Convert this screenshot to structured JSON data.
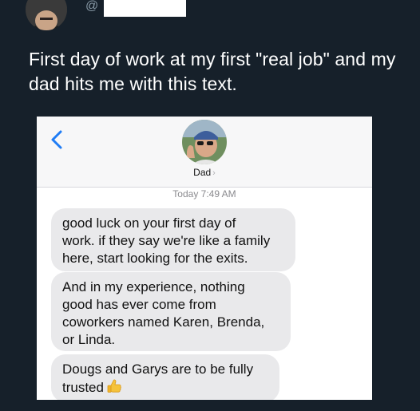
{
  "tweet": {
    "at_symbol": "@",
    "text": "First day of work at my first \"real job\" and my dad hits me with this text."
  },
  "messages_app": {
    "back_icon": "chevron-left-icon",
    "contact_name": "Dad",
    "contact_chevron": "›",
    "timestamp": "Today 7:49 AM",
    "accent_color": "#1f7cf5",
    "bubble_color": "#e9e9eb",
    "messages": [
      {
        "text": "good luck on your first day of\nwork. if they say we're like a family\nhere, start looking for the exits."
      },
      {
        "text": "And in my experience, nothing\ngood has ever come from\ncoworkers named Karen, Brenda,\nor Linda."
      },
      {
        "text": "Dougs and Garys are to be fully\ntrusted",
        "emoji": "thumbs-up-icon"
      }
    ]
  }
}
